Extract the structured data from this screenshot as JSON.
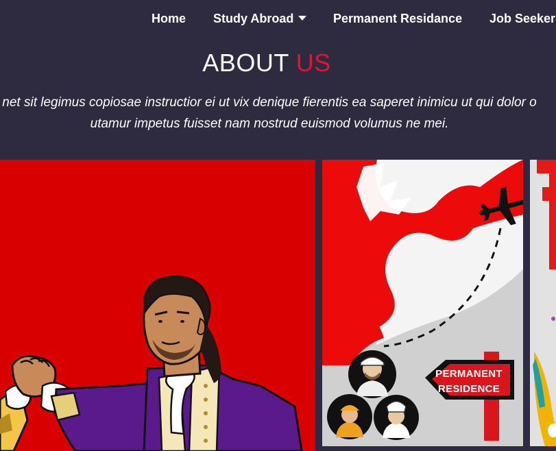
{
  "nav": {
    "items": [
      {
        "label": "Home"
      },
      {
        "label": "Study Abroad",
        "has_dropdown": true,
        "icon": "caret-down-icon"
      },
      {
        "label": "Permanent Residance"
      },
      {
        "label": "Job Seeker"
      }
    ]
  },
  "about": {
    "title_main": "ABOUT",
    "title_accent": "US",
    "accent_color": "#e8112f",
    "text_line1": "net sit legimus copiosae instructior ei ut vix denique fierentis ea saperet inimicu ut qui dolor o",
    "text_line2": "utamur impetus fuisset nam nostrud euismod volumus ne mei."
  },
  "gallery": {
    "tiles": [
      {
        "name": "duel-illustration",
        "background": "#d80000"
      },
      {
        "name": "permanent-residence-illustration",
        "background": "#cfcfcf",
        "sign_text_line1": "PERMANENT",
        "sign_text_line2": "RESIDENCE"
      },
      {
        "name": "partial-tile",
        "background": "#dedede"
      }
    ]
  },
  "colors": {
    "background": "#2e2a40",
    "nav_text": "#ffffff",
    "accent_red": "#e8112f"
  }
}
